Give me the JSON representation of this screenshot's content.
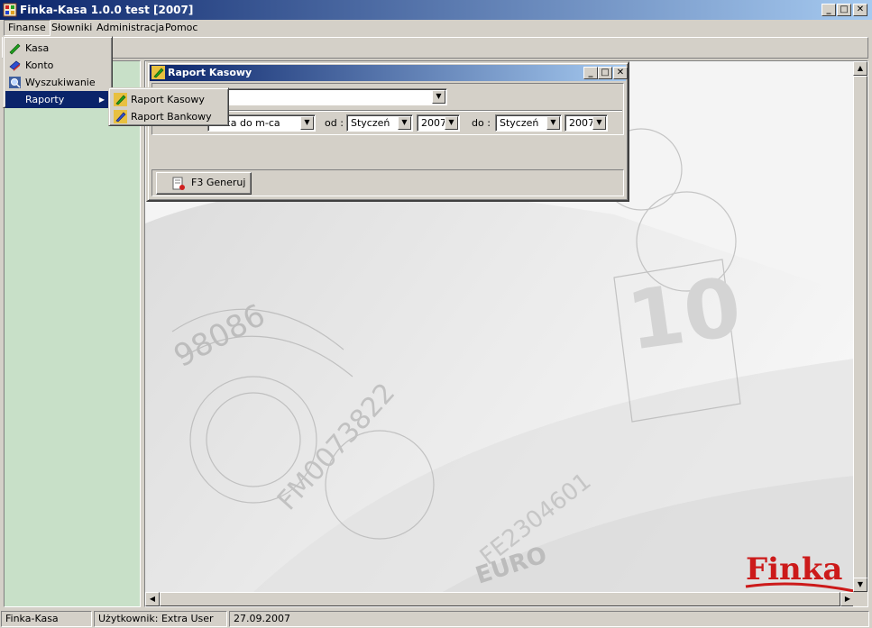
{
  "window": {
    "title": "Finka-Kasa 1.0.0 test [2007]"
  },
  "menubar": {
    "items": [
      {
        "label": "Finanse"
      },
      {
        "label": "Słowniki"
      },
      {
        "label": "Administracja"
      },
      {
        "label": "Pomoc"
      }
    ]
  },
  "finanse_menu": {
    "items": [
      {
        "label": "Kasa",
        "icon": "green-pen-icon"
      },
      {
        "label": "Konto",
        "icon": "blue-card-icon"
      },
      {
        "label": "Wyszukiwanie",
        "icon": "search-icon"
      },
      {
        "label": "Raporty",
        "icon": "submenu-arrow-icon"
      }
    ]
  },
  "raporty_submenu": {
    "items": [
      {
        "label": "Raport Kasowy",
        "icon": "green-pen-icon"
      },
      {
        "label": "Raport Bankowy",
        "icon": "blue-pen-icon"
      }
    ]
  },
  "dialog": {
    "title": "Raport Kasowy",
    "account_combo": {
      "value": ""
    },
    "period_type": {
      "value": "m-ca do m-ca"
    },
    "od_label": "od :",
    "od_month": {
      "value": "Styczeń"
    },
    "od_year": {
      "value": "2007"
    },
    "do_label": "do :",
    "do_month": {
      "value": "Styczeń"
    },
    "do_year": {
      "value": "2007"
    },
    "generate_button": {
      "label": "F3 Generuj"
    }
  },
  "logo": {
    "text": "Finka"
  },
  "statusbar": {
    "app": "Finka-Kasa",
    "user": "Użytkownik: Extra User",
    "date": "27.09.2007"
  },
  "colors": {
    "titlebar_start": "#0a246a",
    "titlebar_end": "#a6caf0",
    "left_panel": "#c8e0c8",
    "menu_highlight": "#0a246a",
    "logo_red": "#cc1a1a"
  }
}
